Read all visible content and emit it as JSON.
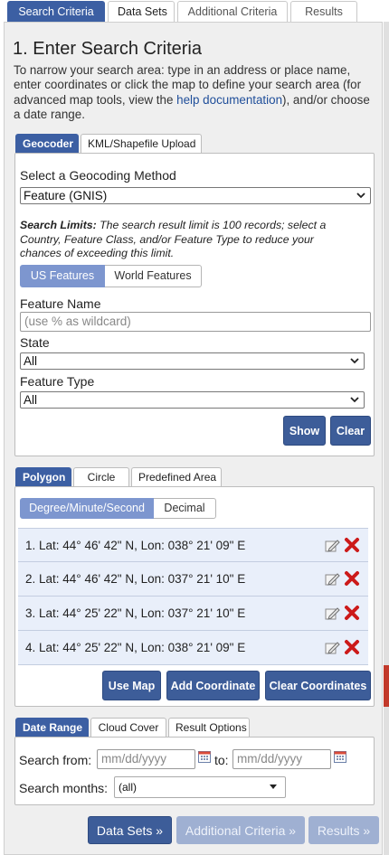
{
  "top_tabs": [
    "Search Criteria",
    "Data Sets",
    "Additional Criteria",
    "Results"
  ],
  "title": "1. Enter Search Criteria",
  "intro": {
    "before_link": "To narrow your search area: type in an address or place name, enter coordinates or click the map to define your search area (for advanced map tools, view the ",
    "link": "help documentation",
    "after_link": "), and/or choose a date range."
  },
  "geo_tabs": [
    "Geocoder",
    "KML/Shapefile Upload"
  ],
  "geocoder": {
    "method_label": "Select a Geocoding Method",
    "method_value": "Feature (GNIS)",
    "limits_bold": "Search Limits:",
    "limits_text": " The search result limit is 100 records; select a Country, Feature Class, and/or Feature Type to reduce your chances of exceeding this limit.",
    "feature_tabs": [
      "US Features",
      "World Features"
    ],
    "feature_name_label": "Feature Name",
    "feature_name_placeholder": "(use % as wildcard)",
    "state_label": "State",
    "state_value": "All",
    "feature_type_label": "Feature Type",
    "feature_type_value": "All",
    "show_label": "Show",
    "clear_label": "Clear"
  },
  "area_tabs": [
    "Polygon",
    "Circle",
    "Predefined Area"
  ],
  "polygon": {
    "format_tabs": [
      "Degree/Minute/Second",
      "Decimal"
    ],
    "coordinates": [
      "1.  Lat: 44° 46' 42\" N, Lon: 038° 21' 09\" E",
      "2.  Lat: 44° 46' 42\" N, Lon: 037° 21' 10\" E",
      "3.  Lat: 44° 25' 22\" N, Lon: 037° 21' 10\" E",
      "4.  Lat: 44° 25' 22\" N, Lon: 038° 21' 09\" E"
    ],
    "use_map_label": "Use Map",
    "add_coordinate_label": "Add Coordinate",
    "clear_coordinates_label": "Clear Coordinates"
  },
  "date_tabs": [
    "Date Range",
    "Cloud Cover",
    "Result Options"
  ],
  "date_range": {
    "search_from_label": "Search from:",
    "from_placeholder": "mm/dd/yyyy",
    "to_label": "to:",
    "to_placeholder": "mm/dd/yyyy",
    "months_label": "Search months:",
    "months_value": "(all)"
  },
  "nav": {
    "data_sets": "Data Sets »",
    "additional_criteria": "Additional Criteria »",
    "results": "Results »"
  },
  "colors": {
    "accent": "#3c5fa3",
    "button": "#3d5d99",
    "toggle_active": "#7d96cf",
    "delete_red": "#cc1a1a"
  }
}
